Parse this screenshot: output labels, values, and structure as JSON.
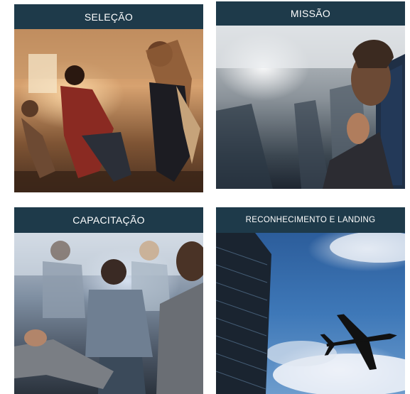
{
  "cards": [
    {
      "title": "SELEÇÃO",
      "image_icon": "group-start-line-photo"
    },
    {
      "title": "MISSÃO",
      "image_icon": "airplane-cabin-photo"
    },
    {
      "title": "CAPACITAÇÃO",
      "image_icon": "training-session-photo"
    },
    {
      "title": "RECONHECIMENTO E LANDING",
      "image_icon": "airplane-sky-photo"
    }
  ],
  "colors": {
    "header_bg": "#1e3a4a",
    "header_text": "#ffffff"
  }
}
